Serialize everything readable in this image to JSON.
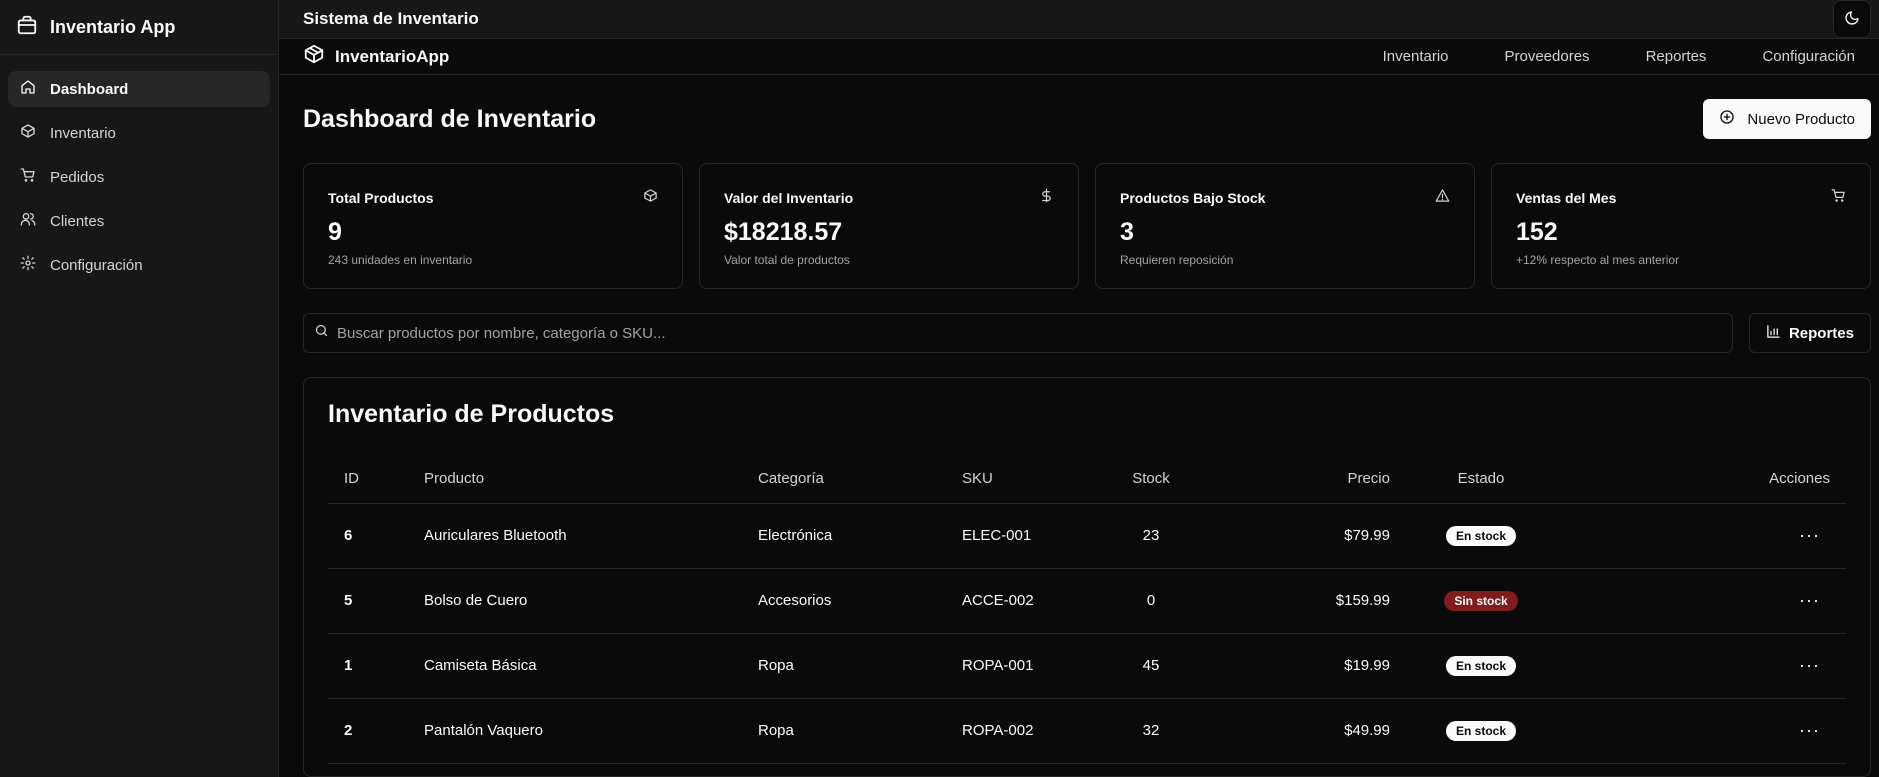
{
  "sidebar": {
    "app_name": "Inventario App",
    "items": [
      {
        "label": "Dashboard",
        "icon": "home-icon",
        "active": true
      },
      {
        "label": "Inventario",
        "icon": "package-icon"
      },
      {
        "label": "Pedidos",
        "icon": "cart-icon"
      },
      {
        "label": "Clientes",
        "icon": "users-icon"
      },
      {
        "label": "Configuración",
        "icon": "gear-icon"
      }
    ]
  },
  "topbar": {
    "title": "Sistema de Inventario",
    "theme_icon": "moon-icon"
  },
  "navbar": {
    "brand": "InventarioApp",
    "links": [
      "Inventario",
      "Proveedores",
      "Reportes",
      "Configuración"
    ]
  },
  "page": {
    "title": "Dashboard de Inventario",
    "new_product_label": "Nuevo Producto"
  },
  "cards": [
    {
      "title": "Total Productos",
      "value": "9",
      "sub": "243 unidades en inventario",
      "icon": "package-icon"
    },
    {
      "title": "Valor del Inventario",
      "value": "$18218.57",
      "sub": "Valor total de productos",
      "icon": "dollar-icon"
    },
    {
      "title": "Productos Bajo Stock",
      "value": "3",
      "sub": "Requieren reposición",
      "icon": "alert-triangle-icon"
    },
    {
      "title": "Ventas del Mes",
      "value": "152",
      "sub": "+12% respecto al mes anterior",
      "icon": "cart-icon"
    }
  ],
  "search": {
    "placeholder": "Buscar productos por nombre, categoría o SKU...",
    "value": ""
  },
  "reports_button": "Reportes",
  "table": {
    "title": "Inventario de Productos",
    "headers": {
      "id": "ID",
      "product": "Producto",
      "category": "Categoría",
      "sku": "SKU",
      "stock": "Stock",
      "price": "Precio",
      "status": "Estado",
      "actions": "Acciones"
    },
    "rows": [
      {
        "id": "6",
        "product": "Auriculares Bluetooth",
        "category": "Electrónica",
        "sku": "ELEC-001",
        "stock": "23",
        "price": "$79.99",
        "status": "En stock"
      },
      {
        "id": "5",
        "product": "Bolso de Cuero",
        "category": "Accesorios",
        "sku": "ACCE-002",
        "stock": "0",
        "price": "$159.99",
        "status": "Sin stock"
      },
      {
        "id": "1",
        "product": "Camiseta Básica",
        "category": "Ropa",
        "sku": "ROPA-001",
        "stock": "45",
        "price": "$19.99",
        "status": "En stock"
      },
      {
        "id": "2",
        "product": "Pantalón Vaquero",
        "category": "Ropa",
        "sku": "ROPA-002",
        "stock": "32",
        "price": "$49.99",
        "status": "En stock"
      }
    ]
  },
  "colors": {
    "background": "#0a0a0a",
    "sidebar": "#171717",
    "border": "#262626",
    "danger": "#7f1d1d"
  }
}
